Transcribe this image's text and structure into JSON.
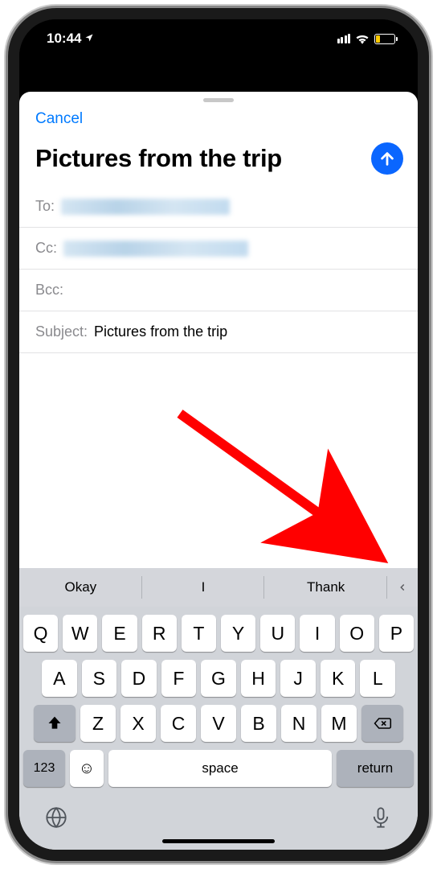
{
  "status": {
    "time": "10:44",
    "location_arrow": "➤"
  },
  "nav": {
    "cancel": "Cancel"
  },
  "compose": {
    "title": "Pictures from the trip",
    "fields": {
      "to_label": "To:",
      "cc_label": "Cc:",
      "bcc_label": "Bcc:",
      "subject_label": "Subject:",
      "subject_value": "Pictures from the trip"
    }
  },
  "keyboard": {
    "predictions": [
      "Okay",
      "I",
      "Thank"
    ],
    "row1": [
      "Q",
      "W",
      "E",
      "R",
      "T",
      "Y",
      "U",
      "I",
      "O",
      "P"
    ],
    "row2": [
      "A",
      "S",
      "D",
      "F",
      "G",
      "H",
      "J",
      "K",
      "L"
    ],
    "row3": [
      "Z",
      "X",
      "C",
      "V",
      "B",
      "N",
      "M"
    ],
    "numeric_label": "123",
    "space_label": "space",
    "return_label": "return"
  },
  "annotation": {
    "arrow_color": "#ff0000"
  }
}
